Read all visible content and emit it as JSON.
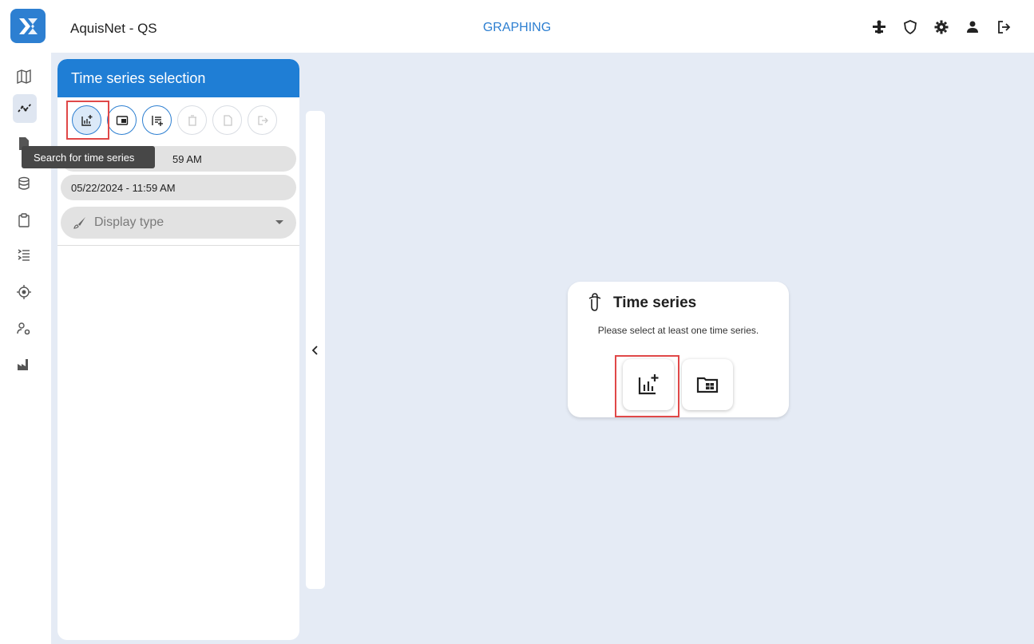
{
  "header": {
    "app_title": "AquisNet - QS",
    "page_title": "GRAPHING",
    "icons": [
      "map-pin-tools-icon",
      "shield-icon",
      "gear-icon",
      "user-icon",
      "logout-icon"
    ]
  },
  "rail": {
    "items": [
      "map-icon",
      "graph-icon",
      "document-icon",
      "database-icon",
      "clipboard-icon",
      "list-icon",
      "target-icon",
      "user-settings-icon",
      "factory-icon"
    ],
    "active": "graph-icon"
  },
  "panel": {
    "title": "Time series selection",
    "tools": [
      "search-time-series",
      "open-folder",
      "add-list",
      "delete",
      "export-document",
      "exit"
    ],
    "tooltip": "Search for time series",
    "start_date_visible": "59 AM",
    "end_date": "05/22/2024 - 11:59 AM",
    "display_type_placeholder": "Display type"
  },
  "card": {
    "title": "Time series",
    "message": "Please select at least one time series."
  },
  "colors": {
    "accent": "#1f7ed5",
    "background": "#e5ebf5",
    "highlight": "#e04848"
  }
}
